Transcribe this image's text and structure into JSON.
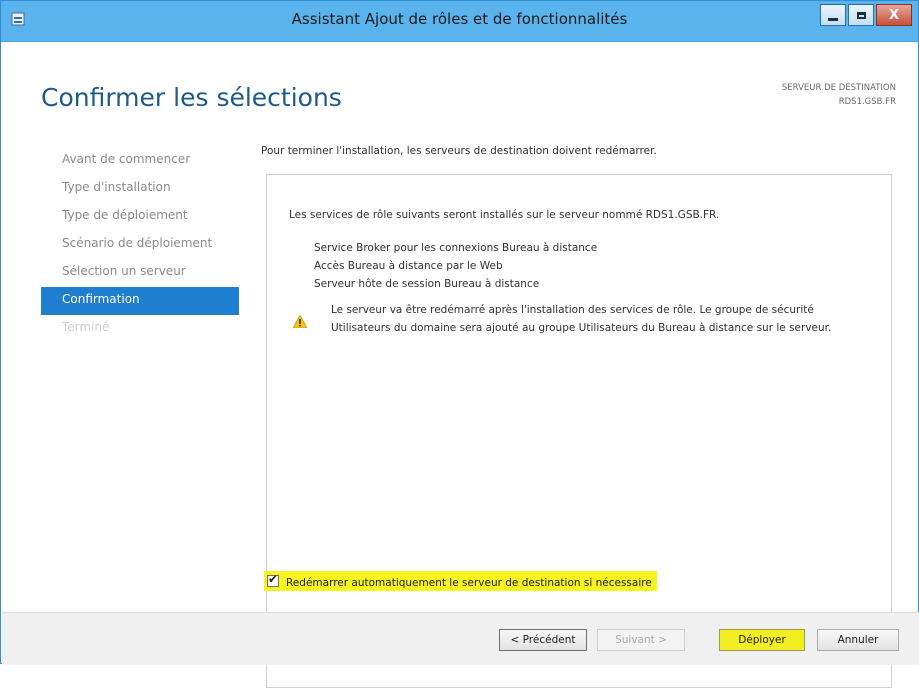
{
  "window": {
    "title": "Assistant Ajout de rôles et de fonctionnalités",
    "close_glyph": "X"
  },
  "header": {
    "page_title": "Confirmer les sélections",
    "destination_label": "SERVEUR DE DESTINATION",
    "destination_server": "RDS1.GSB.FR"
  },
  "sidebar": {
    "items": [
      {
        "label": "Avant de commencer",
        "state": "normal"
      },
      {
        "label": "Type d'installation",
        "state": "normal"
      },
      {
        "label": "Type de déploiement",
        "state": "normal"
      },
      {
        "label": "Scénario de déploiement",
        "state": "normal"
      },
      {
        "label": "Sélection un serveur",
        "state": "normal"
      },
      {
        "label": "Confirmation",
        "state": "active"
      },
      {
        "label": "Terminé",
        "state": "disabled"
      }
    ]
  },
  "content": {
    "intro": "Pour terminer l'installation, les serveurs de destination doivent redémarrer.",
    "summary_heading": "Les services de rôle suivants seront installés sur le serveur nommé RDS1.GSB.FR.",
    "roles": [
      "Service Broker pour les connexions Bureau à distance",
      "Accès Bureau à distance par le Web",
      "Serveur hôte de session Bureau à distance"
    ],
    "warning_lines": [
      "Le serveur va être redémarré après l'installation des services de rôle. Le groupe de sécurité",
      "Utilisateurs du domaine sera ajouté au groupe Utilisateurs du Bureau à distance sur le serveur."
    ],
    "restart_checkbox": {
      "label": "Redémarrer automatiquement le serveur de destination si nécessaire",
      "checked": true
    }
  },
  "footer": {
    "previous": "< Précédent",
    "next": "Suivant >",
    "deploy": "Déployer",
    "cancel": "Annuler"
  },
  "colors": {
    "titlebar": "#5bb3ee",
    "accent": "#1e7fd0",
    "highlight": "#f6f31e",
    "title_text": "#1d5a8a"
  }
}
